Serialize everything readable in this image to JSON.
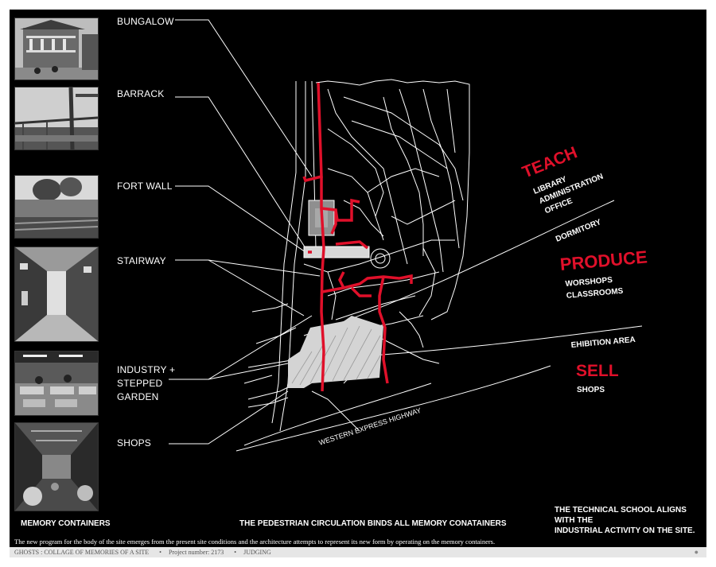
{
  "memory_labels": [
    "BUNGALOW",
    "BARRACK",
    "FORT WALL",
    "STAIRWAY",
    "INDUSTRY + STEPPED GARDEN",
    "SHOPS"
  ],
  "memory_label_lines": {
    "industry": [
      "INDUSTRY +",
      "STEPPED",
      "GARDEN"
    ]
  },
  "program": {
    "teach": {
      "title": "TEACH",
      "items": [
        "LIBRARY",
        "ADMINISTRATION",
        "OFFICE"
      ]
    },
    "dormitory": "DORMITORY",
    "produce": {
      "title": "PRODUCE",
      "items": [
        "WORSHOPS",
        "CLASSROOMS"
      ]
    },
    "exhibition": "EHIBITION AREA",
    "sell": {
      "title": "SELL",
      "items": [
        "SHOPS"
      ]
    }
  },
  "highway_label": "WESTERN EXPRESS HIGHWAY",
  "captions": {
    "memory_containers": "MEMORY CONTAINERS",
    "pedestrian": "THE PEDESTRIAN CIRCULATION BINDS ALL MEMORY CONATAINERS",
    "technical_line1": "THE TECHNICAL SCHOOL ALIGNS  WITH THE",
    "technical_line2": "INDUSTRIAL ACTIVITY ON THE SITE."
  },
  "description": "The new program for the body of the site emerges from the present site conditions and the architecture attempts to represent its new  form by operating on the memory containers.",
  "footer": {
    "title": "GHOSTS : COLLAGE OF MEMORIES OF A SITE",
    "project": "Project number: 2173",
    "status": "JUDGING"
  },
  "colors": {
    "accent_red": "#e0102a",
    "background": "#000000",
    "line": "#ffffff"
  }
}
